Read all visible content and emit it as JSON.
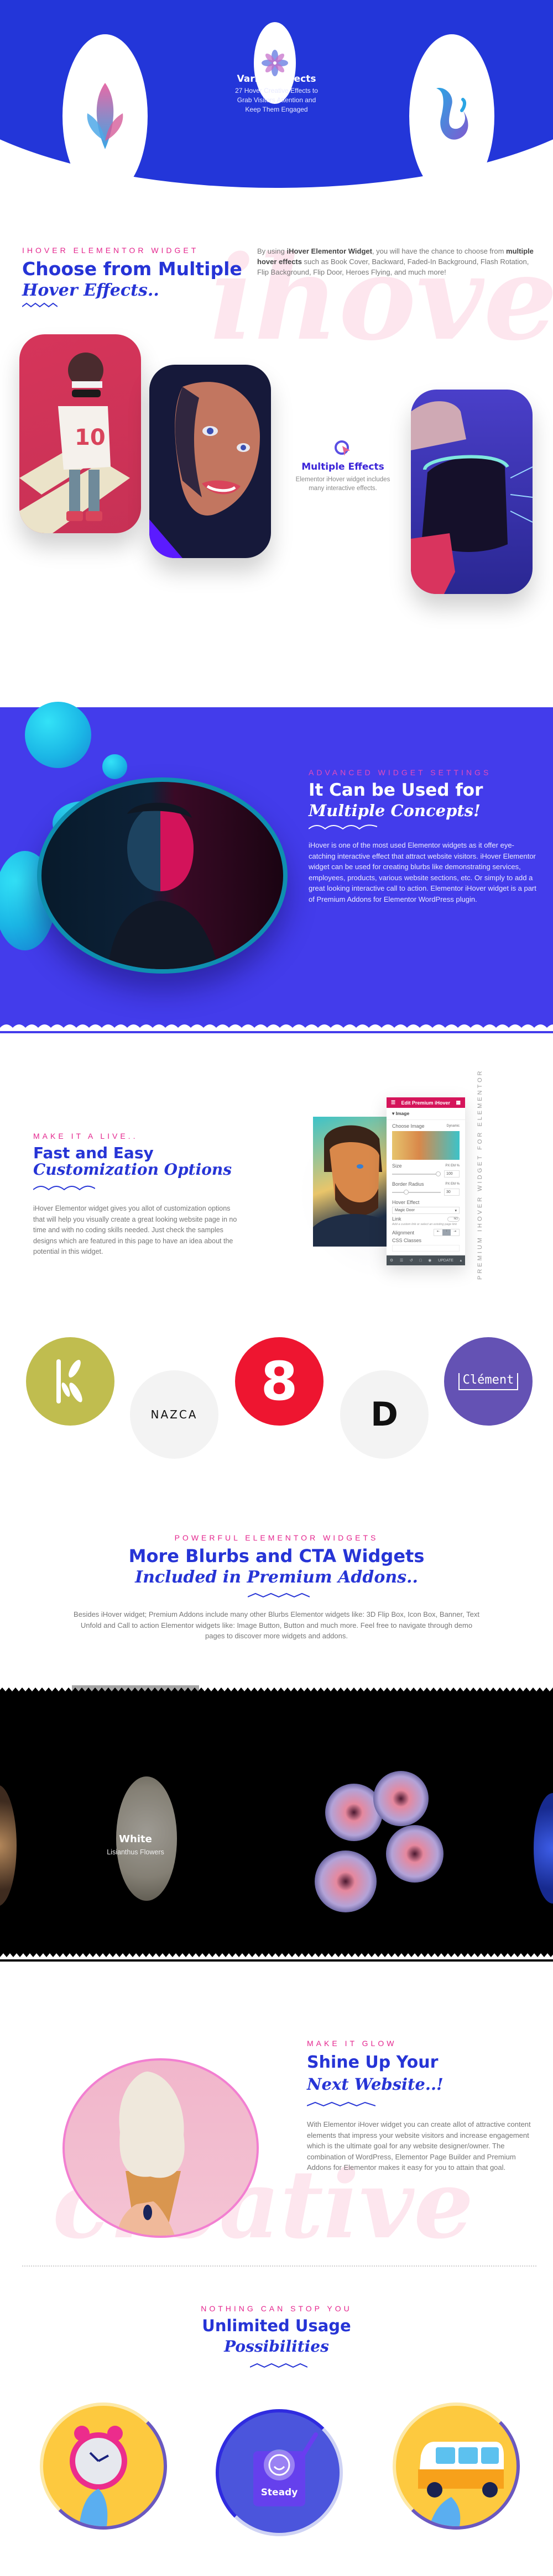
{
  "hero": {
    "title": "Various Effects",
    "description_lines": [
      "27 Hover Creative Effects to",
      "Grab Visitors Attention and",
      "Keep Them Engaged"
    ],
    "colors": {
      "background": "#2336d9"
    },
    "icons": [
      "leaf-icon",
      "flower-icon",
      "splash-icon"
    ]
  },
  "choose": {
    "eyebrow": "iHover Elementor Widget",
    "title_bold": "Choose from Multiple",
    "title_italic": "Hover Effects..",
    "ghost_word": "ihover",
    "intro_prefix": "By using ",
    "intro_bold_1": "iHover Elementor Widget",
    "intro_mid": ", you will have the chance to choose from ",
    "intro_bold_2": "multiple hover effects",
    "intro_suffix": " such as Book Cover, Backward, Faded-In Background, Flash Rotation, Flip Background, Flip Door, Heroes Flying, and much more!",
    "feature_title": "Multiple Effects",
    "feature_desc_lines": [
      "Elementor iHover widget includes",
      "many interactive effects."
    ],
    "cards": [
      "Basketball player illustration",
      "Woman portrait illustration",
      "VR headset illustration"
    ]
  },
  "concepts": {
    "eyebrow": "Advanced Widget Settings",
    "title_bold": "It Can be Used for",
    "title_italic": "Multiple Concepts!",
    "body": "iHover is one of the most used Elementor widgets as it offer eye-catching interactive effect that attract website visitors. iHover Elementor widget can be used for creating blurbs like demonstrating services, employees, products, various website sections, etc. Or simply to add a great looking interactive call to action. Elementor iHover widget is a part of Premium Addons for Elementor WordPress plugin.",
    "colors": {
      "background": "#433ceb",
      "accent": "#e44bbd"
    }
  },
  "customization": {
    "eyebrow": "Make it a live..",
    "title_bold": "Fast and Easy",
    "title_italic": "Customization Options",
    "body": "iHover Elementor widget gives you allot of customization options that will help you visually create a great looking website page in no time and with no coding skills needed. Just check the samples designs which are featured in this page to have an idea about the potential in this widget.",
    "vertical_label": "Premium iHover Widget for Elementor",
    "panel": {
      "header": "Edit Premium iHover",
      "section": "Image",
      "choose_image": "Choose Image",
      "dynamic": "Dynamic",
      "size_label": "Size",
      "size_value": "100",
      "size_fraction": 0.95,
      "units": "PX EM %",
      "radius_label": "Border Radius",
      "radius_value": "30",
      "radius_fraction": 0.3,
      "hover_effect_label": "Hover Effect",
      "hover_effect_value": "Magic Door",
      "link_label": "Link",
      "link_toggle": "NO",
      "link_hint": "Add a custom link or select an existing page link",
      "alignment_label": "Alignment",
      "css_classes_label": "CSS Classes",
      "update": "UPDATE",
      "header_color": "#d5145a"
    }
  },
  "logos": [
    {
      "name": "K",
      "bg": "#c0bd4f",
      "fg": "#ffffff"
    },
    {
      "name": "NAZCA",
      "bg": "#f3f3f3",
      "fg": "#111111"
    },
    {
      "name": "8",
      "bg": "#ee1530",
      "fg": "#ffffff"
    },
    {
      "name": "D",
      "bg": "#f3f3f3",
      "fg": "#111111"
    },
    {
      "name": "Clément",
      "bg": "#6452b4",
      "fg": "#ffffff"
    }
  ],
  "blurbs": {
    "eyebrow": "Powerful Elementor Widgets",
    "title_bold": "More Blurbs and CTA Widgets",
    "title_italic": "Included in Premium Addons..",
    "body": "Besides iHover widget; Premium Addons include many other Blurbs Elementor widgets like: 3D Flip Box, Icon Box, Banner, Text Unfold and Call to action Elementor widgets like: Image Button, Button and much more. Feel free to navigate through demo pages to discover more widgets and addons."
  },
  "flowers": {
    "caption_title": "White",
    "caption_sub": "Lisianthus Flowers"
  },
  "glow": {
    "eyebrow": "Make it Glow",
    "title_bold": "Shine Up Your",
    "title_italic": "Next Website..!",
    "ghost_word": "creative",
    "body": "With Elementor iHover widget you can create allot of attractive content elements that impress your website visitors and increase engagement which is the ultimate goal for any website designer/owner. The combination of WordPress, Elementor Page Builder and Premium Addons for Elementor makes it easy for you to attain that goal."
  },
  "usage": {
    "eyebrow": "Nothing can stop you",
    "title_bold": "Unlimited Usage",
    "title_italic": "Possibilities",
    "items": [
      {
        "label": "Alarm clock",
        "bg": "#fdc93f"
      },
      {
        "label": "Steady",
        "bg": "#4b55dc"
      },
      {
        "label": "Van",
        "bg": "#fdc93f"
      }
    ]
  }
}
